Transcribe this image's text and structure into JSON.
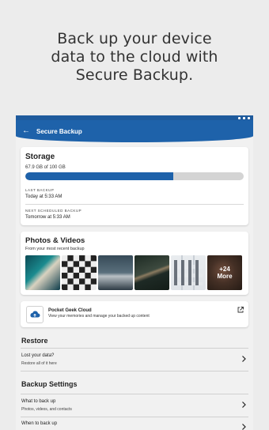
{
  "promo": {
    "line1": "Back up your device",
    "line2": "data to the cloud with",
    "line3": "Secure Backup."
  },
  "appbar": {
    "title": "Secure Backup",
    "back_icon": "arrow-back-icon",
    "color": "#1e62aa"
  },
  "storage": {
    "title": "Storage",
    "used_text": "67.9 GB of 100 GB",
    "used_fraction": 0.679,
    "last_backup_label": "LAST BACKUP",
    "last_backup_value": "Today at 5:33 AM",
    "next_backup_label": "NEXT SCHEDULED BACKUP",
    "next_backup_value": "Tomorrow at 5:33 AM"
  },
  "photos": {
    "title": "Photos & Videos",
    "subtitle": "From your most recent backup",
    "more_count": "+24",
    "more_label": "More"
  },
  "cloud": {
    "name": "Pocket Geek Cloud",
    "description": "View your memories and manage your backed up content",
    "external_icon": "open-external-icon"
  },
  "restore": {
    "heading": "Restore",
    "row_title": "Lost your data?",
    "row_subtitle": "Restore all of it here"
  },
  "backup_settings": {
    "heading": "Backup Settings",
    "rows": [
      {
        "title": "What to back up",
        "subtitle": "Photos, videos, and contacts"
      },
      {
        "title": "When to back up",
        "subtitle": ""
      }
    ]
  }
}
